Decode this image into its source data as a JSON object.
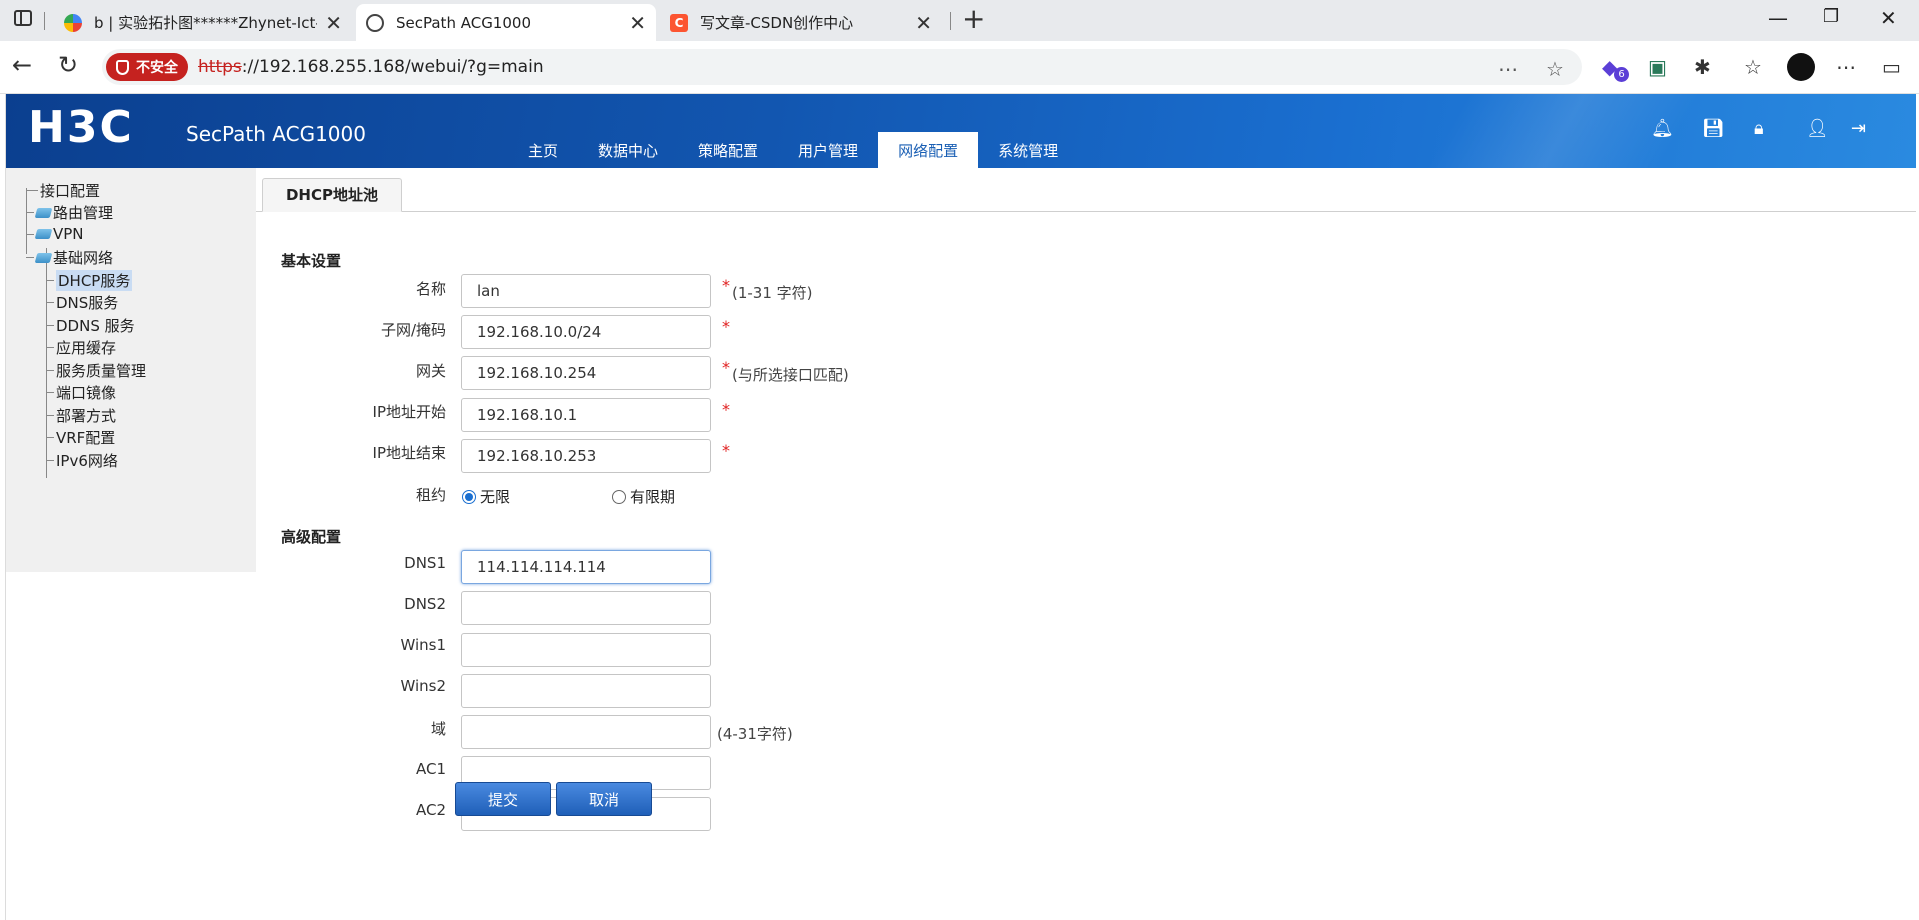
{
  "browser": {
    "tabs": [
      {
        "title": "b | 实验拓扑图******Zhynet-Ict-La"
      },
      {
        "title": "SecPath ACG1000"
      },
      {
        "title": "写文章-CSDN创作中心"
      }
    ],
    "security_label": "不安全",
    "url_protocol": "https",
    "url_rest": "://192.168.255.168/webui/?g=main",
    "extension_badge": "6",
    "icons": [
      "back-icon",
      "reload-icon",
      "more-icon",
      "favorite-icon",
      "extension-icon",
      "favorites-list-icon",
      "menu-icon",
      "sidebar-icon"
    ]
  },
  "header": {
    "logo": "H3C",
    "product": "SecPath ACG1000",
    "nav": [
      "主页",
      "数据中心",
      "策略配置",
      "用户管理",
      "网络配置",
      "系统管理"
    ],
    "active_nav": "网络配置",
    "icons": [
      "bell-icon",
      "save-icon",
      "lock-icon",
      "user-icon",
      "logout-icon"
    ]
  },
  "sidebar": {
    "items": [
      {
        "label": "接口配置"
      },
      {
        "label": "路由管理"
      },
      {
        "label": "VPN"
      },
      {
        "label": "基础网络"
      },
      {
        "label": "DHCP服务"
      },
      {
        "label": "DNS服务"
      },
      {
        "label": "DDNS 服务"
      },
      {
        "label": "应用缓存"
      },
      {
        "label": "服务质量管理"
      },
      {
        "label": "端口镜像"
      },
      {
        "label": "部署方式"
      },
      {
        "label": "VRF配置"
      },
      {
        "label": "IPv6网络"
      }
    ],
    "selected": "DHCP服务"
  },
  "main": {
    "tab": "DHCP地址池",
    "basic": {
      "title": "基本设置",
      "name_label": "名称",
      "name_value": "lan",
      "name_hint": "(1-31 字符)",
      "subnet_label": "子网/掩码",
      "subnet_value": "192.168.10.0/24",
      "gateway_label": "网关",
      "gateway_value": "192.168.10.254",
      "gateway_hint": "(与所选接口匹配)",
      "start_label": "IP地址开始",
      "start_value": "192.168.10.1",
      "end_label": "IP地址结束",
      "end_value": "192.168.10.253",
      "lease_label": "租约",
      "lease_unlimited": "无限",
      "lease_limited": "有限期",
      "required_mark": "*"
    },
    "advanced": {
      "title": "高级配置",
      "dns1_label": "DNS1",
      "dns1_value": "114.114.114.114",
      "dns2_label": "DNS2",
      "dns2_value": "",
      "wins1_label": "Wins1",
      "wins1_value": "",
      "wins2_label": "Wins2",
      "wins2_value": "",
      "domain_label": "域",
      "domain_value": "",
      "domain_hint": "(4-31字符)",
      "ac1_label": "AC1",
      "ac1_value": "",
      "ac2_label": "AC2",
      "ac2_value": ""
    },
    "submit_label": "提交",
    "cancel_label": "取消"
  }
}
